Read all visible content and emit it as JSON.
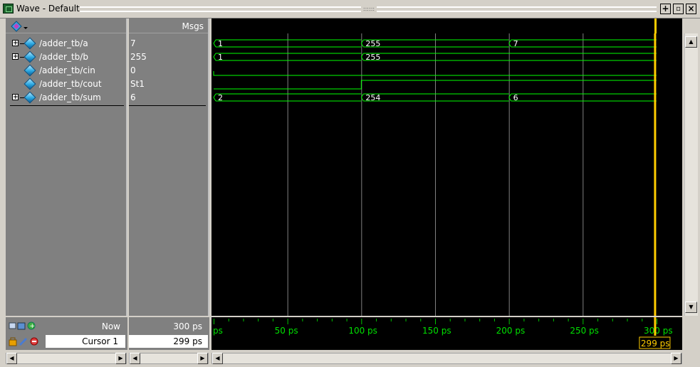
{
  "window": {
    "title": "Wave - Default",
    "grip_dots": "::::::",
    "buttons": [
      "+",
      "▫",
      "×"
    ]
  },
  "headers": {
    "msgs": "Msgs"
  },
  "signals": [
    {
      "name": "/adder_tb/a",
      "value": "7",
      "expandable": true
    },
    {
      "name": "/adder_tb/b",
      "value": "255",
      "expandable": true
    },
    {
      "name": "/adder_tb/cin",
      "value": "0",
      "expandable": false
    },
    {
      "name": "/adder_tb/cout",
      "value": "St1",
      "expandable": false
    },
    {
      "name": "/adder_tb/sum",
      "value": "6",
      "expandable": true
    }
  ],
  "waves": {
    "a": [
      "1",
      "255",
      "7"
    ],
    "b": [
      "1",
      "255"
    ],
    "sum": [
      "2",
      "254",
      "6"
    ]
  },
  "timeline": {
    "now_label": "Now",
    "now_value": "300 ps",
    "cursor_label": "Cursor 1",
    "cursor_value": "299 ps",
    "cursor_tag": "299 ps",
    "ticks": [
      "ps",
      "50 ps",
      "100 ps",
      "150 ps",
      "200 ps",
      "250 ps",
      "300 ps"
    ]
  },
  "colors": {
    "wave": "#00ff00",
    "cursor": "#ffcc00",
    "grid": "#808080"
  }
}
